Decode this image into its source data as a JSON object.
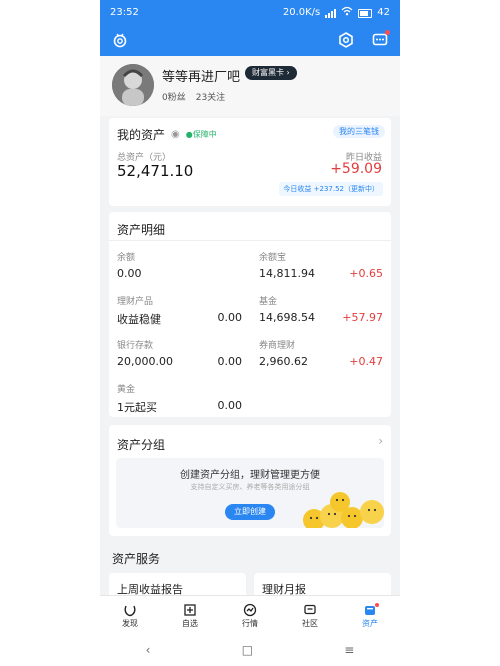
{
  "status_bar": {
    "time": "23:52",
    "net_speed": "20.0K/s",
    "battery": "42"
  },
  "profile": {
    "name": "等等再进厂吧",
    "vip_badge": "财富黑卡",
    "followers": "0粉丝",
    "following": "23关注"
  },
  "assets": {
    "title": "我的资产",
    "protect_label": "保障中",
    "link_label": "我的三笔钱",
    "total_label": "总资产（元）",
    "total_value": "52,471.10",
    "yesterday_label": "昨日收益",
    "yesterday_value": "+59.09",
    "today_note": "今日收益 +237.52（更新中）"
  },
  "details": {
    "title": "资产明细",
    "items": [
      {
        "label": "余额",
        "value": "0.00",
        "change": ""
      },
      {
        "label": "余额宝",
        "value": "14,811.94",
        "change": "+0.65"
      },
      {
        "label": "理财产品",
        "value": "收益稳健",
        "change": "0.00"
      },
      {
        "label": "基金",
        "value": "14,698.54",
        "change": "+57.97"
      },
      {
        "label": "银行存款",
        "value": "20,000.00",
        "change": "0.00"
      },
      {
        "label": "券商理财",
        "value": "2,960.62",
        "change": "+0.47"
      },
      {
        "label": "黄金",
        "value": "1元起买",
        "change": "0.00"
      }
    ]
  },
  "group": {
    "title": "资产分组",
    "promo_title": "创建资产分组，理财管理更方便",
    "promo_sub": "支持自定义买房、养老等各类用途分组",
    "button": "立即创建"
  },
  "services": {
    "title": "资产服务",
    "items": [
      "上周收益报告",
      "理财月报"
    ]
  },
  "tabbar": {
    "items": [
      {
        "label": "发现",
        "icon": "discover-icon"
      },
      {
        "label": "自选",
        "icon": "watchlist-icon"
      },
      {
        "label": "行情",
        "icon": "market-icon"
      },
      {
        "label": "社区",
        "icon": "community-icon"
      },
      {
        "label": "资产",
        "icon": "assets-icon"
      }
    ]
  },
  "colors": {
    "brand_blue": "#2a86f0",
    "gain_red": "#e23d3d",
    "green": "#22b26a",
    "gold": "#f6c72d"
  }
}
